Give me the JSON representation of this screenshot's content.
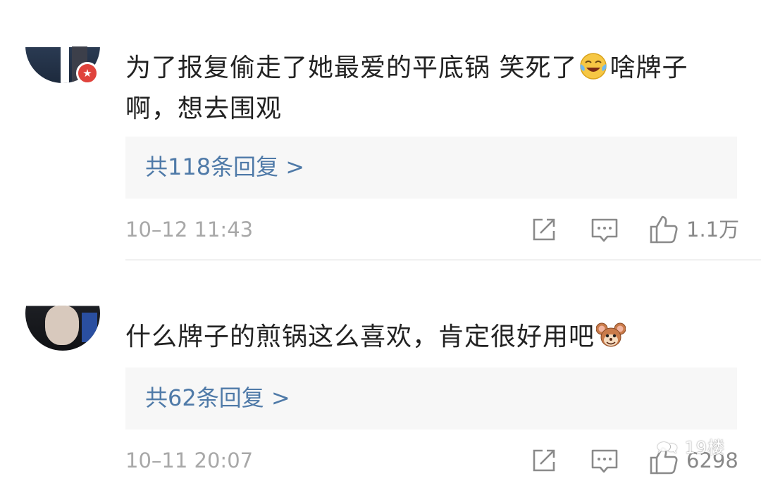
{
  "comments": [
    {
      "text_part1": "为了报复偷走了她最爱的平底锅 笑死了",
      "emoji": "laughing-crying-emoji",
      "text_part2": "啥牌子啊，想去围观",
      "reply_link": "共118条回复 >",
      "timestamp": "10–12 11:43",
      "like_count": "1.1万"
    },
    {
      "text_part1": "什么牌子的煎锅这么喜欢，肯定很好用吧",
      "emoji": "jerry-mouse-emoji",
      "text_part2": "",
      "reply_link": "共62条回复 >",
      "timestamp": "10–11 20:07",
      "like_count": "6298"
    }
  ],
  "watermark": "19楼",
  "colors": {
    "link": "#4f7aa8",
    "meta": "#a8a8a8",
    "reply_bg": "#f7f7f7",
    "badge": "#e0433c"
  }
}
